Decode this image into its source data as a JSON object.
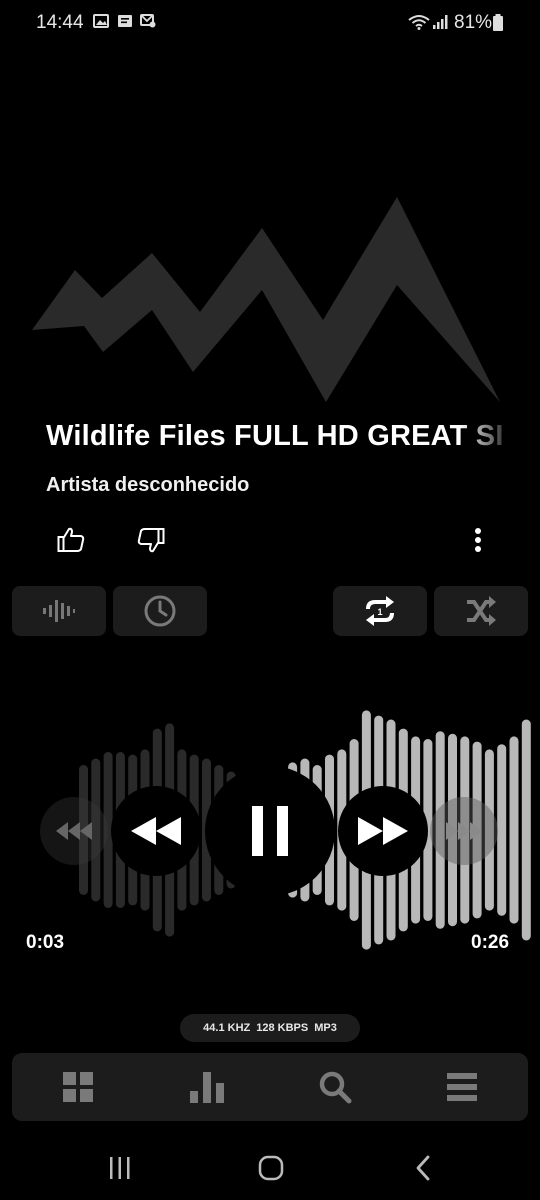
{
  "status_bar": {
    "time": "14:44",
    "battery": "81%",
    "left_icons": [
      "image-icon",
      "message-icon",
      "mail-settings-icon"
    ],
    "right_icons": [
      "wifi-icon",
      "signal-icon",
      "battery-icon"
    ]
  },
  "track": {
    "title": "Wildlife Files FULL HD GREAT SI",
    "artist": "Artista desconhecido"
  },
  "rating": {
    "like_icon": "thumbs-up-icon",
    "dislike_icon": "thumbs-down-icon",
    "more_icon": "more-vertical-icon"
  },
  "toolbar": {
    "chips": [
      "waveform-icon",
      "sleep-timer-icon",
      "repeat-one-icon",
      "shuffle-icon"
    ]
  },
  "player": {
    "current_time": "0:03",
    "total_time": "0:26",
    "state": "playing",
    "buttons": [
      "previous-track-icon",
      "rewind-icon",
      "pause-icon",
      "fast-forward-icon",
      "next-track-icon"
    ]
  },
  "format": {
    "sample_rate": "44.1 KHZ",
    "bitrate": "128 KBPS",
    "codec": "MP3"
  },
  "bottom_nav": {
    "items": [
      "grid-icon",
      "chart-icon",
      "search-icon",
      "menu-icon"
    ]
  },
  "system_nav": {
    "items": [
      "recent-apps-icon",
      "home-icon",
      "back-icon"
    ]
  },
  "colors": {
    "background": "#000000",
    "chip": "#1c1c1c",
    "artwork": "#2a2a2a"
  }
}
